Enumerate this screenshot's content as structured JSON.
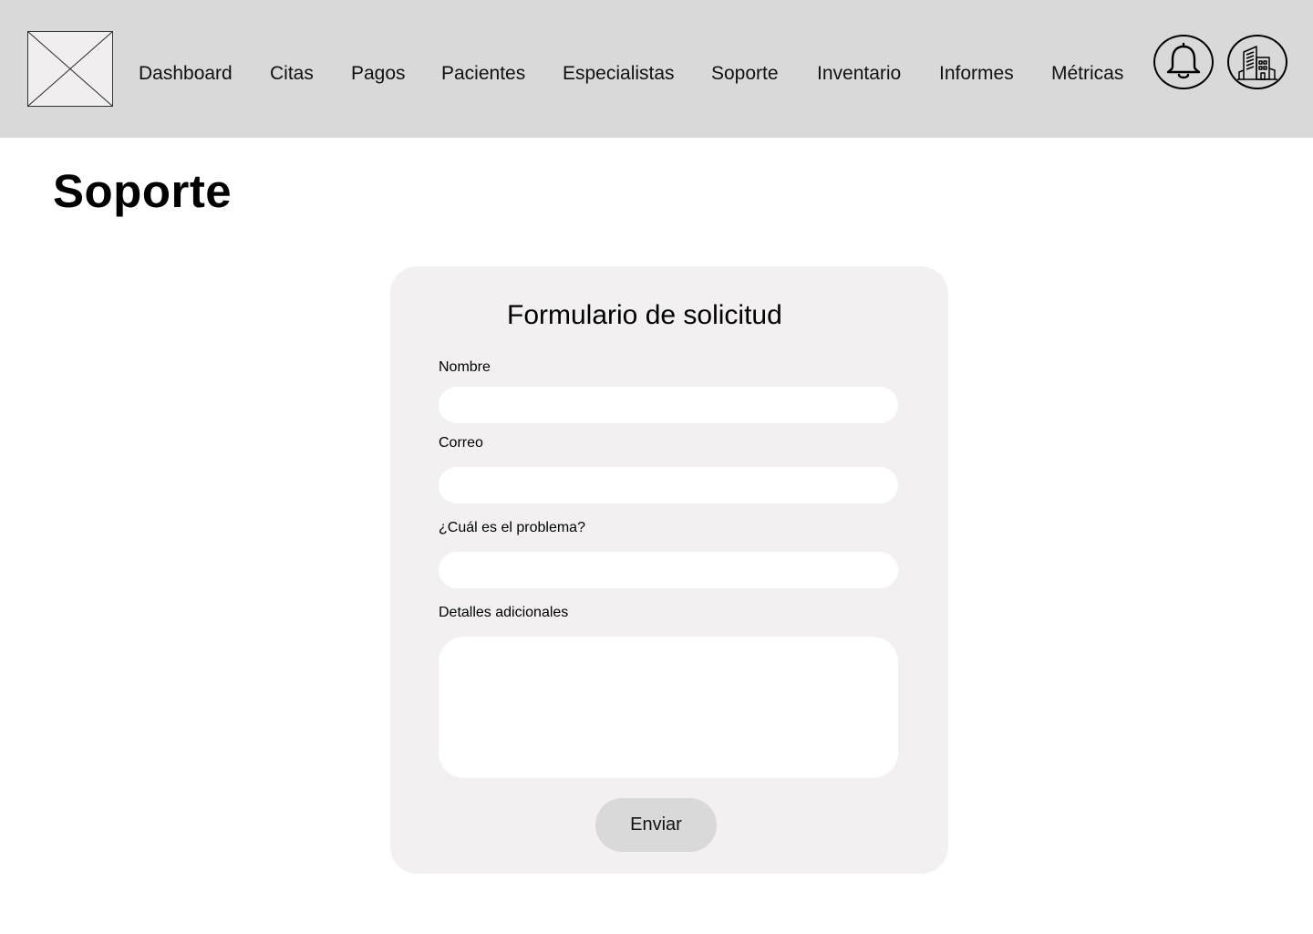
{
  "header": {
    "logo_icon": "image-placeholder-icon",
    "nav": [
      {
        "label": "Dashboard"
      },
      {
        "label": "Citas"
      },
      {
        "label": "Pagos"
      },
      {
        "label": "Pacientes"
      },
      {
        "label": "Especialistas"
      },
      {
        "label": "Soporte"
      },
      {
        "label": "Inventario"
      },
      {
        "label": "Informes"
      },
      {
        "label": "Métricas"
      }
    ],
    "actions": [
      {
        "icon": "bell-icon"
      },
      {
        "icon": "building-icon"
      }
    ]
  },
  "page": {
    "title": "Soporte"
  },
  "form": {
    "title": "Formulario de solicitud",
    "fields": {
      "name": {
        "label": "Nombre",
        "value": ""
      },
      "email": {
        "label": "Correo",
        "value": ""
      },
      "problem": {
        "label": "¿Cuál es el problema?",
        "value": ""
      },
      "details": {
        "label": "Detalles adicionales",
        "value": ""
      }
    },
    "submit_label": "Enviar"
  },
  "colors": {
    "header_bg": "#d9d9d9",
    "card_bg": "#f2f0f0",
    "input_bg": "#ffffff",
    "button_bg": "#d9d9d9"
  }
}
